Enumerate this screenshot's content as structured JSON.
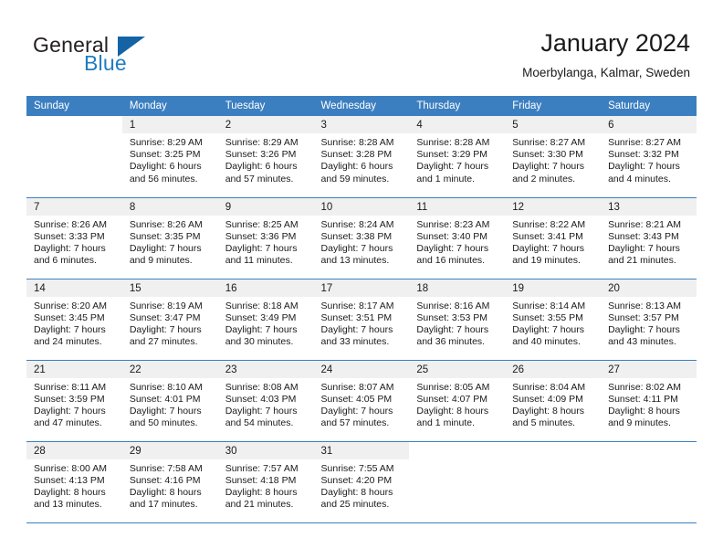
{
  "brand": {
    "name_part1": "General",
    "name_part2": "Blue",
    "logo_icon": "triangle-icon",
    "accent_color": "#1f7cc1",
    "header_color": "#3c7fc0"
  },
  "header": {
    "title": "January 2024",
    "subtitle": "Moerbylanga, Kalmar, Sweden"
  },
  "calendar": {
    "weekday_headers": [
      "Sunday",
      "Monday",
      "Tuesday",
      "Wednesday",
      "Thursday",
      "Friday",
      "Saturday"
    ],
    "weeks": [
      [
        {
          "day": "",
          "blank": true,
          "sunrise": "",
          "sunset": "",
          "daylight_line1": "",
          "daylight_line2": ""
        },
        {
          "day": "1",
          "sunrise": "Sunrise: 8:29 AM",
          "sunset": "Sunset: 3:25 PM",
          "daylight_line1": "Daylight: 6 hours",
          "daylight_line2": "and 56 minutes."
        },
        {
          "day": "2",
          "sunrise": "Sunrise: 8:29 AM",
          "sunset": "Sunset: 3:26 PM",
          "daylight_line1": "Daylight: 6 hours",
          "daylight_line2": "and 57 minutes."
        },
        {
          "day": "3",
          "sunrise": "Sunrise: 8:28 AM",
          "sunset": "Sunset: 3:28 PM",
          "daylight_line1": "Daylight: 6 hours",
          "daylight_line2": "and 59 minutes."
        },
        {
          "day": "4",
          "sunrise": "Sunrise: 8:28 AM",
          "sunset": "Sunset: 3:29 PM",
          "daylight_line1": "Daylight: 7 hours",
          "daylight_line2": "and 1 minute."
        },
        {
          "day": "5",
          "sunrise": "Sunrise: 8:27 AM",
          "sunset": "Sunset: 3:30 PM",
          "daylight_line1": "Daylight: 7 hours",
          "daylight_line2": "and 2 minutes."
        },
        {
          "day": "6",
          "sunrise": "Sunrise: 8:27 AM",
          "sunset": "Sunset: 3:32 PM",
          "daylight_line1": "Daylight: 7 hours",
          "daylight_line2": "and 4 minutes."
        }
      ],
      [
        {
          "day": "7",
          "sunrise": "Sunrise: 8:26 AM",
          "sunset": "Sunset: 3:33 PM",
          "daylight_line1": "Daylight: 7 hours",
          "daylight_line2": "and 6 minutes."
        },
        {
          "day": "8",
          "sunrise": "Sunrise: 8:26 AM",
          "sunset": "Sunset: 3:35 PM",
          "daylight_line1": "Daylight: 7 hours",
          "daylight_line2": "and 9 minutes."
        },
        {
          "day": "9",
          "sunrise": "Sunrise: 8:25 AM",
          "sunset": "Sunset: 3:36 PM",
          "daylight_line1": "Daylight: 7 hours",
          "daylight_line2": "and 11 minutes."
        },
        {
          "day": "10",
          "sunrise": "Sunrise: 8:24 AM",
          "sunset": "Sunset: 3:38 PM",
          "daylight_line1": "Daylight: 7 hours",
          "daylight_line2": "and 13 minutes."
        },
        {
          "day": "11",
          "sunrise": "Sunrise: 8:23 AM",
          "sunset": "Sunset: 3:40 PM",
          "daylight_line1": "Daylight: 7 hours",
          "daylight_line2": "and 16 minutes."
        },
        {
          "day": "12",
          "sunrise": "Sunrise: 8:22 AM",
          "sunset": "Sunset: 3:41 PM",
          "daylight_line1": "Daylight: 7 hours",
          "daylight_line2": "and 19 minutes."
        },
        {
          "day": "13",
          "sunrise": "Sunrise: 8:21 AM",
          "sunset": "Sunset: 3:43 PM",
          "daylight_line1": "Daylight: 7 hours",
          "daylight_line2": "and 21 minutes."
        }
      ],
      [
        {
          "day": "14",
          "sunrise": "Sunrise: 8:20 AM",
          "sunset": "Sunset: 3:45 PM",
          "daylight_line1": "Daylight: 7 hours",
          "daylight_line2": "and 24 minutes."
        },
        {
          "day": "15",
          "sunrise": "Sunrise: 8:19 AM",
          "sunset": "Sunset: 3:47 PM",
          "daylight_line1": "Daylight: 7 hours",
          "daylight_line2": "and 27 minutes."
        },
        {
          "day": "16",
          "sunrise": "Sunrise: 8:18 AM",
          "sunset": "Sunset: 3:49 PM",
          "daylight_line1": "Daylight: 7 hours",
          "daylight_line2": "and 30 minutes."
        },
        {
          "day": "17",
          "sunrise": "Sunrise: 8:17 AM",
          "sunset": "Sunset: 3:51 PM",
          "daylight_line1": "Daylight: 7 hours",
          "daylight_line2": "and 33 minutes."
        },
        {
          "day": "18",
          "sunrise": "Sunrise: 8:16 AM",
          "sunset": "Sunset: 3:53 PM",
          "daylight_line1": "Daylight: 7 hours",
          "daylight_line2": "and 36 minutes."
        },
        {
          "day": "19",
          "sunrise": "Sunrise: 8:14 AM",
          "sunset": "Sunset: 3:55 PM",
          "daylight_line1": "Daylight: 7 hours",
          "daylight_line2": "and 40 minutes."
        },
        {
          "day": "20",
          "sunrise": "Sunrise: 8:13 AM",
          "sunset": "Sunset: 3:57 PM",
          "daylight_line1": "Daylight: 7 hours",
          "daylight_line2": "and 43 minutes."
        }
      ],
      [
        {
          "day": "21",
          "sunrise": "Sunrise: 8:11 AM",
          "sunset": "Sunset: 3:59 PM",
          "daylight_line1": "Daylight: 7 hours",
          "daylight_line2": "and 47 minutes."
        },
        {
          "day": "22",
          "sunrise": "Sunrise: 8:10 AM",
          "sunset": "Sunset: 4:01 PM",
          "daylight_line1": "Daylight: 7 hours",
          "daylight_line2": "and 50 minutes."
        },
        {
          "day": "23",
          "sunrise": "Sunrise: 8:08 AM",
          "sunset": "Sunset: 4:03 PM",
          "daylight_line1": "Daylight: 7 hours",
          "daylight_line2": "and 54 minutes."
        },
        {
          "day": "24",
          "sunrise": "Sunrise: 8:07 AM",
          "sunset": "Sunset: 4:05 PM",
          "daylight_line1": "Daylight: 7 hours",
          "daylight_line2": "and 57 minutes."
        },
        {
          "day": "25",
          "sunrise": "Sunrise: 8:05 AM",
          "sunset": "Sunset: 4:07 PM",
          "daylight_line1": "Daylight: 8 hours",
          "daylight_line2": "and 1 minute."
        },
        {
          "day": "26",
          "sunrise": "Sunrise: 8:04 AM",
          "sunset": "Sunset: 4:09 PM",
          "daylight_line1": "Daylight: 8 hours",
          "daylight_line2": "and 5 minutes."
        },
        {
          "day": "27",
          "sunrise": "Sunrise: 8:02 AM",
          "sunset": "Sunset: 4:11 PM",
          "daylight_line1": "Daylight: 8 hours",
          "daylight_line2": "and 9 minutes."
        }
      ],
      [
        {
          "day": "28",
          "sunrise": "Sunrise: 8:00 AM",
          "sunset": "Sunset: 4:13 PM",
          "daylight_line1": "Daylight: 8 hours",
          "daylight_line2": "and 13 minutes."
        },
        {
          "day": "29",
          "sunrise": "Sunrise: 7:58 AM",
          "sunset": "Sunset: 4:16 PM",
          "daylight_line1": "Daylight: 8 hours",
          "daylight_line2": "and 17 minutes."
        },
        {
          "day": "30",
          "sunrise": "Sunrise: 7:57 AM",
          "sunset": "Sunset: 4:18 PM",
          "daylight_line1": "Daylight: 8 hours",
          "daylight_line2": "and 21 minutes."
        },
        {
          "day": "31",
          "sunrise": "Sunrise: 7:55 AM",
          "sunset": "Sunset: 4:20 PM",
          "daylight_line1": "Daylight: 8 hours",
          "daylight_line2": "and 25 minutes."
        },
        {
          "day": "",
          "blank": true,
          "sunrise": "",
          "sunset": "",
          "daylight_line1": "",
          "daylight_line2": ""
        },
        {
          "day": "",
          "blank": true,
          "sunrise": "",
          "sunset": "",
          "daylight_line1": "",
          "daylight_line2": ""
        },
        {
          "day": "",
          "blank": true,
          "sunrise": "",
          "sunset": "",
          "daylight_line1": "",
          "daylight_line2": ""
        }
      ]
    ]
  }
}
